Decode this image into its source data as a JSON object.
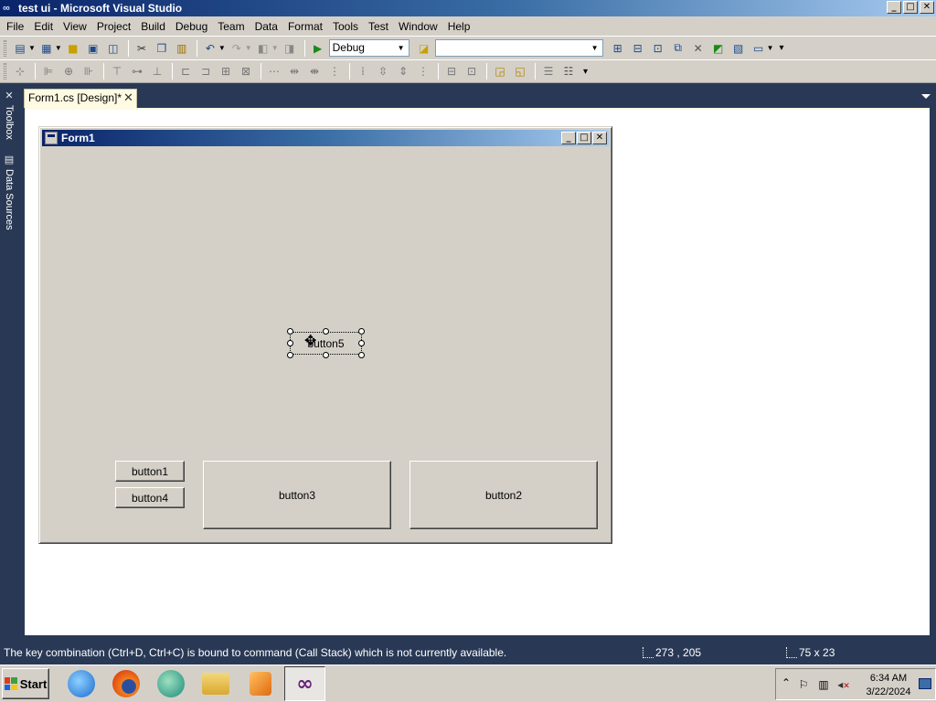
{
  "window": {
    "title": "test ui - Microsoft Visual Studio",
    "controls": [
      "_",
      "□",
      "✕"
    ]
  },
  "menubar": {
    "items": [
      "File",
      "Edit",
      "View",
      "Project",
      "Build",
      "Debug",
      "Team",
      "Data",
      "Format",
      "Tools",
      "Test",
      "Window",
      "Help"
    ]
  },
  "toolbar": {
    "config_value": "Debug",
    "platform_value": ""
  },
  "siderail": {
    "tabs": [
      "Toolbox",
      "Data Sources"
    ]
  },
  "document_tab": {
    "label": "Form1.cs [Design]*",
    "close": "✕"
  },
  "form": {
    "title": "Form1",
    "buttons": {
      "button1": "button1",
      "button2": "button2",
      "button3": "button3",
      "button4": "button4",
      "button5": "button5"
    }
  },
  "statusbar": {
    "message": "The key combination (Ctrl+D, Ctrl+C) is bound to command (Call Stack) which is not currently available.",
    "position": "273 , 205",
    "size": "75 x 23"
  },
  "taskbar": {
    "start_label": "Start",
    "clock_time": "6:34 AM",
    "clock_date": "3/22/2024",
    "apps": [
      "internet-explorer",
      "firefox",
      "browser",
      "file-explorer",
      "media-player",
      "visual-studio"
    ]
  },
  "colors": {
    "titlebar_start": "#0a246a",
    "titlebar_end": "#a6caf0",
    "chrome": "#d4d0c8",
    "ide_dark": "#293955"
  }
}
